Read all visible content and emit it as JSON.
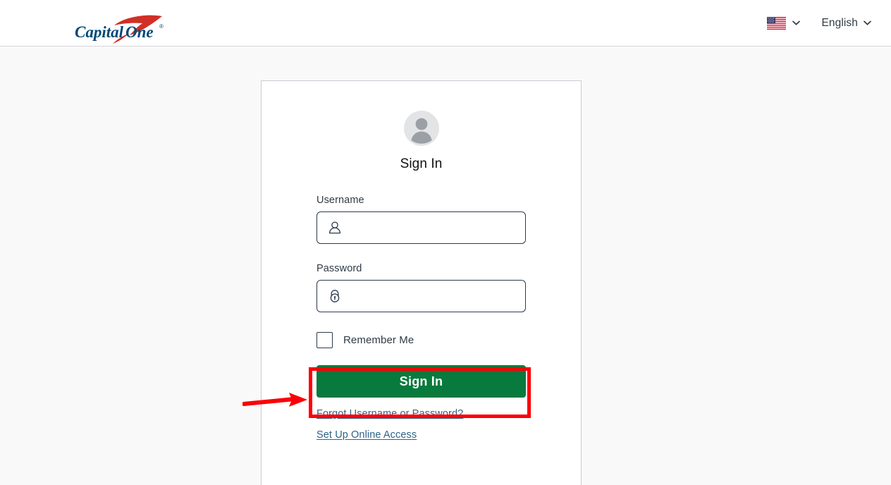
{
  "header": {
    "logo": {
      "name": "capital-one-logo",
      "text_primary": "Capital",
      "text_secondary": "One",
      "trademark": "®",
      "color_navy": "#004878",
      "color_red": "#d03027"
    },
    "locale": {
      "flag_icon": "us-flag-icon",
      "flag_alt": "United States",
      "chevron_icon": "chevron-down-icon"
    },
    "language": {
      "label": "English",
      "chevron_icon": "chevron-down-icon"
    }
  },
  "card": {
    "avatar_icon": "user-avatar-icon",
    "title": "Sign In",
    "username": {
      "label": "Username",
      "value": "",
      "placeholder": "",
      "icon": "person-outline-icon"
    },
    "password": {
      "label": "Password",
      "value": "",
      "placeholder": "",
      "icon": "lock-icon"
    },
    "remember": {
      "label": "Remember Me",
      "checked": false
    },
    "submit_label": "Sign In",
    "links": [
      {
        "label": "Forgot Username or Password?"
      },
      {
        "label": "Set Up Online Access"
      }
    ]
  },
  "annotation": {
    "highlight_target": "Sign In",
    "box_color": "#fb0007",
    "arrow_color": "#fb0007",
    "arrow_icon": "arrow-right-icon"
  },
  "colors": {
    "brand_green": "#097a3d",
    "brand_navy": "#004878",
    "brand_red": "#d03027",
    "link": "#2d6389",
    "page_background": "#f9f9f9",
    "card_background": "#ffffff",
    "border": "#c9ccd4",
    "input_border": "#2b3b4d"
  }
}
